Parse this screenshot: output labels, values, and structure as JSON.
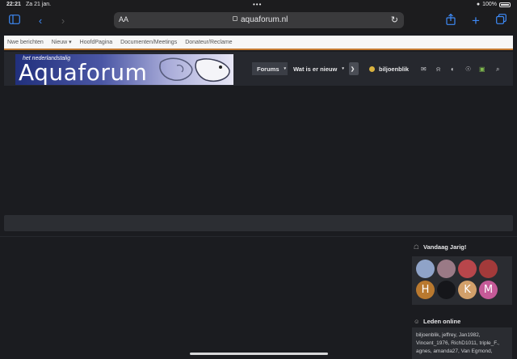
{
  "status": {
    "time": "22:21",
    "date": "Za 21 jan.",
    "battery": "100%"
  },
  "browser": {
    "text_size": "AA",
    "url": "aquaforum.nl"
  },
  "topnav": {
    "items": [
      "Nwe berichten",
      "Nieuw ▾",
      "HoofdPagina",
      "Documenten/Meetings",
      "Donateur/Reclame"
    ]
  },
  "header": {
    "logo_small": "het nederlandstalig",
    "logo_big": "Aquaforum",
    "forums": "Forums",
    "wat_is_er_nieuw": "Wat is er nieuw",
    "username": "biljoenblik"
  },
  "sidebar": {
    "birthday_title": "Vandaag Jarig!",
    "avatars": [
      {
        "label": "",
        "color": "#8fa3c8"
      },
      {
        "label": "",
        "color": "#9a7a86"
      },
      {
        "label": "",
        "color": "#b8464b"
      },
      {
        "label": "",
        "color": "#a33a3a"
      },
      {
        "label": "H",
        "color": "#b9792f"
      },
      {
        "label": "",
        "color": "#15161a"
      },
      {
        "label": "K",
        "color": "#d2a06a"
      },
      {
        "label": "M",
        "color": "#c55a98"
      }
    ],
    "online_title": "Leden online",
    "online_text": "biljoenblik, jeffrey, Jan1982, Vincent_1976, RichD1011, triple_F., agnes, amanda27, Van Egmond,"
  },
  "colors": {
    "accent": "#c57b32",
    "link_blue": "#3e8af7",
    "background": "#1b1c20"
  }
}
